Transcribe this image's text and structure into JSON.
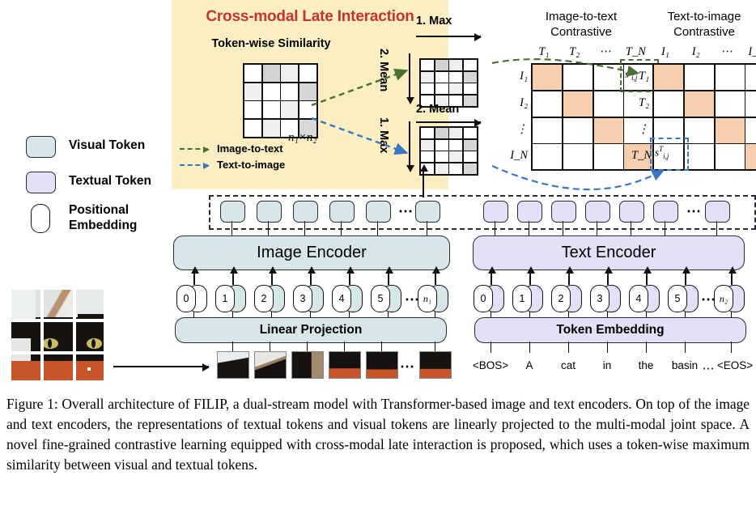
{
  "panel": {
    "title": "Cross-modal Late Interaction",
    "bg_color": "#faeec2",
    "title_color": "#c3342f",
    "tokenwise_title": "Token-wise Similarity",
    "grid_dims_label": "n₁×n₂",
    "step_labels": {
      "top_horizontal": "1. Max",
      "top_vertical": "2. Mean",
      "bottom_horizontal": "2. Mean",
      "bottom_vertical": "1. Max"
    },
    "arrow_legend": [
      {
        "label": "Image-to-text",
        "color": "#4b7033"
      },
      {
        "label": "Text-to-image",
        "color": "#3a76c4"
      }
    ]
  },
  "legend": {
    "items": [
      {
        "label": "Visual Token",
        "shape": "rounded-square",
        "color": "#d6e6e9"
      },
      {
        "label": "Textual Token",
        "shape": "rounded-square",
        "color": "#e3e0f7"
      },
      {
        "label": "Positional Embedding",
        "shape": "capsule",
        "color": "#ffffff"
      }
    ]
  },
  "matrices": {
    "image_to_text": {
      "title_line1": "Image-to-text",
      "title_line2": "Contrastive",
      "col_labels": [
        "T₁",
        "T₂",
        "⋯",
        "T_N"
      ],
      "row_labels": [
        "I₁",
        "I₂",
        "⋮",
        "I_N"
      ],
      "highlight_color": "#f6cfae",
      "score_label": "s",
      "score_sup": "I",
      "score_sub": "i,j",
      "score_cell": "row0-col3",
      "callout_color": "#4b7033"
    },
    "text_to_image": {
      "title_line1": "Text-to-image",
      "title_line2": "Contrastive",
      "col_labels": [
        "I₁",
        "I₂",
        "⋯",
        "I_N"
      ],
      "row_labels": [
        "T₁",
        "T₂",
        "⋮",
        "T_N"
      ],
      "highlight_color": "#f6cfae",
      "score_label": "s",
      "score_sup": "T",
      "score_sub": "i,j",
      "score_cell": "row3-col0",
      "callout_color": "#3a76c4"
    }
  },
  "image_branch": {
    "encoder_label": "Image Encoder",
    "projection_label": "Linear Projection",
    "token_color": "#d6e6e9",
    "output_token_count": 6,
    "output_token_ellipsis_after": 5,
    "positions": [
      "0",
      "1",
      "2",
      "3",
      "4",
      "5",
      "⋯",
      "n₁"
    ],
    "cls_marker": "*",
    "patch_count": 6,
    "patch_ellipsis_after": 5
  },
  "text_branch": {
    "encoder_label": "Text Encoder",
    "embedding_label": "Token Embedding",
    "token_color": "#e3e0f7",
    "output_token_count": 7,
    "output_token_ellipsis_after": 6,
    "positions": [
      "0",
      "1",
      "2",
      "3",
      "4",
      "5",
      "⋯",
      "n₂"
    ],
    "words": [
      "<BOS>",
      "A",
      "cat",
      "in",
      "the",
      "basin",
      "⋯",
      "<EOS>"
    ]
  },
  "caption": {
    "text": "Figure 1: Overall architecture of FILIP, a dual-stream model with Transformer-based image and text encoders. On top of the image and text encoders, the representations of textual tokens and visual tokens are linearly projected to the multi-modal joint space. A novel fine-grained contrastive learning equipped with cross-modal late interaction is proposed, which uses a token-wise maximum similarity between visual and textual tokens."
  },
  "chart_data": {
    "type": "heatmap",
    "title": "Token-wise Similarity",
    "xlabel": "n₂",
    "ylabel": "n₁",
    "values": [
      [
        0.05,
        0.55,
        0.2,
        0.05
      ],
      [
        0.18,
        0.05,
        0.05,
        0.5
      ],
      [
        0.05,
        0.05,
        0.18,
        0.05
      ],
      [
        0.05,
        0.18,
        0.05,
        0.45
      ]
    ]
  }
}
